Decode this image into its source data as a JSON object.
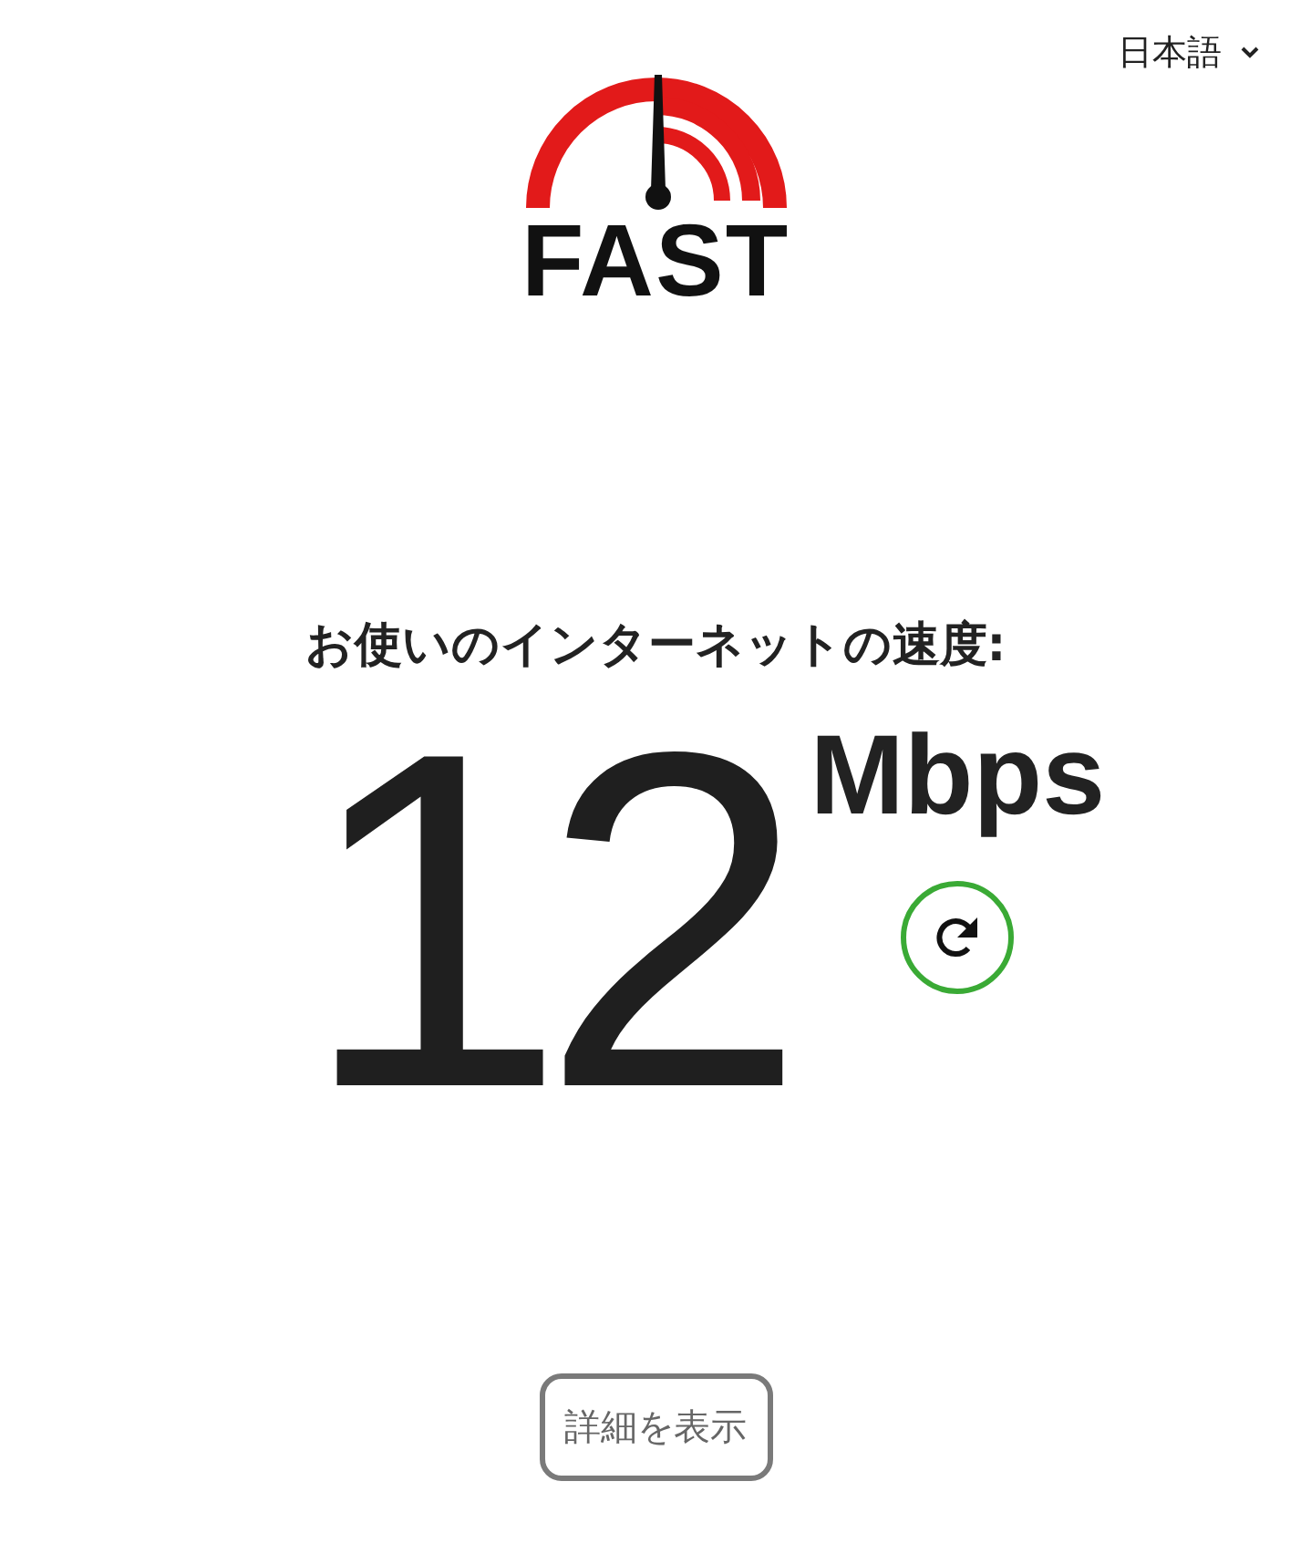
{
  "language_selector": {
    "label": "日本語"
  },
  "logo": {
    "text": "FAST"
  },
  "headline": "お使いのインターネットの速度:",
  "speed": {
    "value": "12",
    "unit": "Mbps"
  },
  "details_button": {
    "label": "詳細を表示"
  }
}
